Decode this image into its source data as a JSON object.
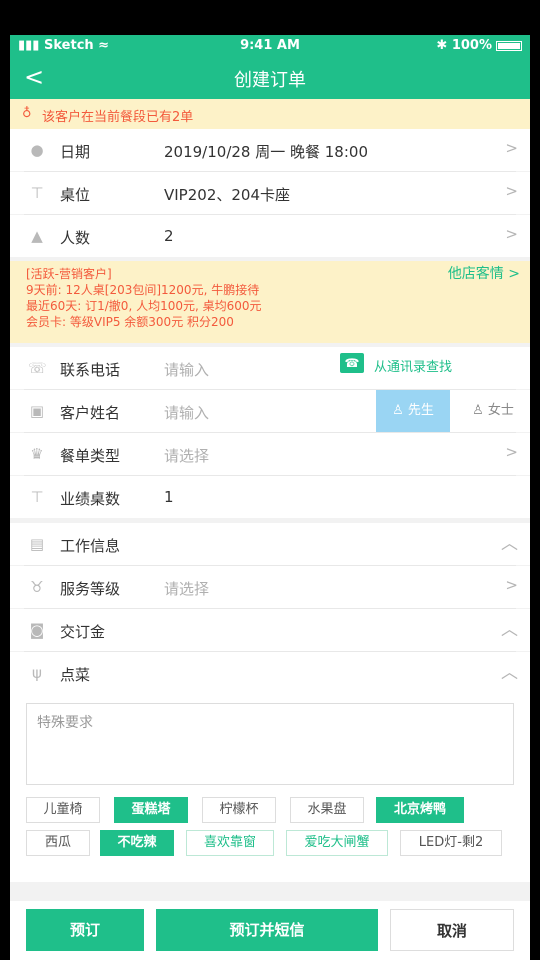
{
  "status": {
    "carrier": "Sketch",
    "time": "9:41 AM",
    "battery": "100%"
  },
  "nav": {
    "back": "<",
    "title": "创建订单"
  },
  "alert": {
    "text": "该客户在当前餐段已有2单"
  },
  "order": {
    "date": {
      "label": "日期",
      "value": "2019/10/28 周一 晚餐 18:00"
    },
    "table": {
      "label": "桌位",
      "value": "VIP202、204卡座"
    },
    "people": {
      "label": "人数",
      "value": "2"
    }
  },
  "customer": {
    "lines": [
      "[活跃-营销客户]",
      "9天前: 12人桌[203包间]1200元, 牛鹏接待",
      "最近60天: 订1/撤0, 人均100元, 桌均600元",
      "会员卡: 等级VIP5 余额300元 积分200"
    ],
    "link": "他店客情 >"
  },
  "form": {
    "phone": {
      "label": "联系电话",
      "placeholder": "请输入",
      "book": "从通讯录查找"
    },
    "name": {
      "label": "客户姓名",
      "placeholder": "请输入",
      "male": "先生",
      "female": "女士"
    },
    "menu_type": {
      "label": "餐单类型",
      "placeholder": "请选择"
    },
    "perf": {
      "label": "业绩桌数",
      "value": "1"
    }
  },
  "sections": {
    "work": "工作信息",
    "service": {
      "label": "服务等级",
      "placeholder": "请选择"
    },
    "deposit": "交订金",
    "dish": "点菜"
  },
  "memo": {
    "placeholder": "特殊要求"
  },
  "tags": [
    "儿童椅",
    "蛋糕塔",
    "柠檬杯",
    "水果盘",
    "北京烤鸭",
    "西瓜",
    "不吃辣",
    "喜欢靠窗",
    "爱吃大闸蟹",
    "LED灯-剩2"
  ],
  "buttons": {
    "book": "预订",
    "book_sms": "预订并短信",
    "cancel": "取消"
  },
  "colors": {
    "primary": "#1fbf8a",
    "warning": "#f35a3c",
    "banner": "#fdf2c8"
  }
}
